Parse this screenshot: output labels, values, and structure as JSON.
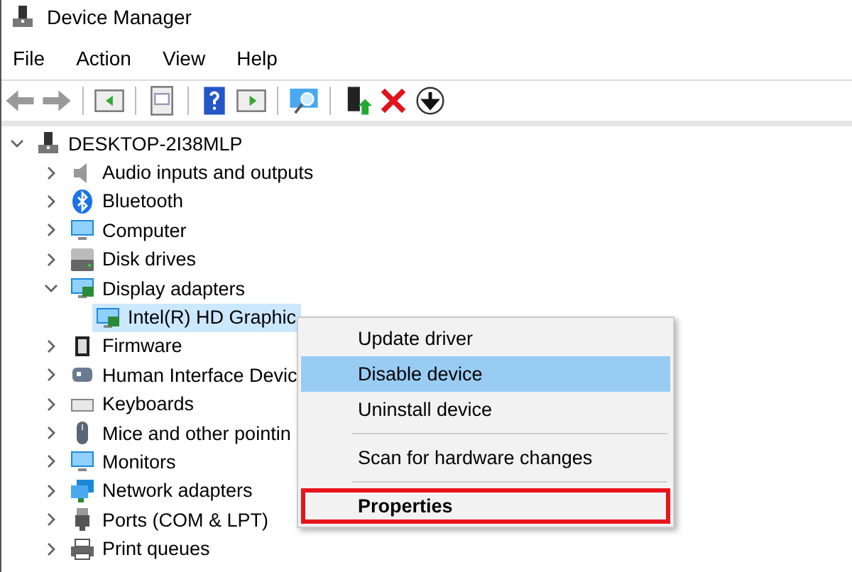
{
  "window": {
    "title": "Device Manager"
  },
  "menu_bar": [
    "File",
    "Action",
    "View",
    "Help"
  ],
  "tree": {
    "label": "DESKTOP-2I38MLP",
    "expanded": true,
    "children": [
      {
        "label": "Audio inputs and outputs",
        "expanded": false,
        "selected": false
      },
      {
        "label": "Bluetooth",
        "expanded": false,
        "selected": false
      },
      {
        "label": "Computer",
        "expanded": false,
        "selected": false
      },
      {
        "label": "Disk drives",
        "expanded": false,
        "selected": false
      },
      {
        "label": "Display adapters",
        "expanded": true,
        "selected": false,
        "children": [
          {
            "label": "Intel(R) HD Graphic",
            "selected": true
          }
        ]
      },
      {
        "label": "Firmware",
        "expanded": false,
        "selected": false
      },
      {
        "label": "Human Interface Devic",
        "expanded": false,
        "selected": false
      },
      {
        "label": "Keyboards",
        "expanded": false,
        "selected": false
      },
      {
        "label": "Mice and other pointin",
        "expanded": false,
        "selected": false
      },
      {
        "label": "Monitors",
        "expanded": false,
        "selected": false
      },
      {
        "label": "Network adapters",
        "expanded": false,
        "selected": false
      },
      {
        "label": "Ports (COM & LPT)",
        "expanded": false,
        "selected": false
      },
      {
        "label": "Print queues",
        "expanded": false,
        "selected": false
      }
    ]
  },
  "context_menu": [
    {
      "kind": "item",
      "label": "Update driver",
      "selected": false,
      "default": false,
      "highlighted": false
    },
    {
      "kind": "item",
      "label": "Disable device",
      "selected": true,
      "default": false,
      "highlighted": false
    },
    {
      "kind": "item",
      "label": "Uninstall device",
      "selected": false,
      "default": false,
      "highlighted": false
    },
    {
      "kind": "separator"
    },
    {
      "kind": "item",
      "label": "Scan for hardware changes",
      "selected": false,
      "default": false,
      "highlighted": false
    },
    {
      "kind": "separator"
    },
    {
      "kind": "item",
      "label": "Properties",
      "selected": false,
      "default": true,
      "highlighted": true
    }
  ]
}
